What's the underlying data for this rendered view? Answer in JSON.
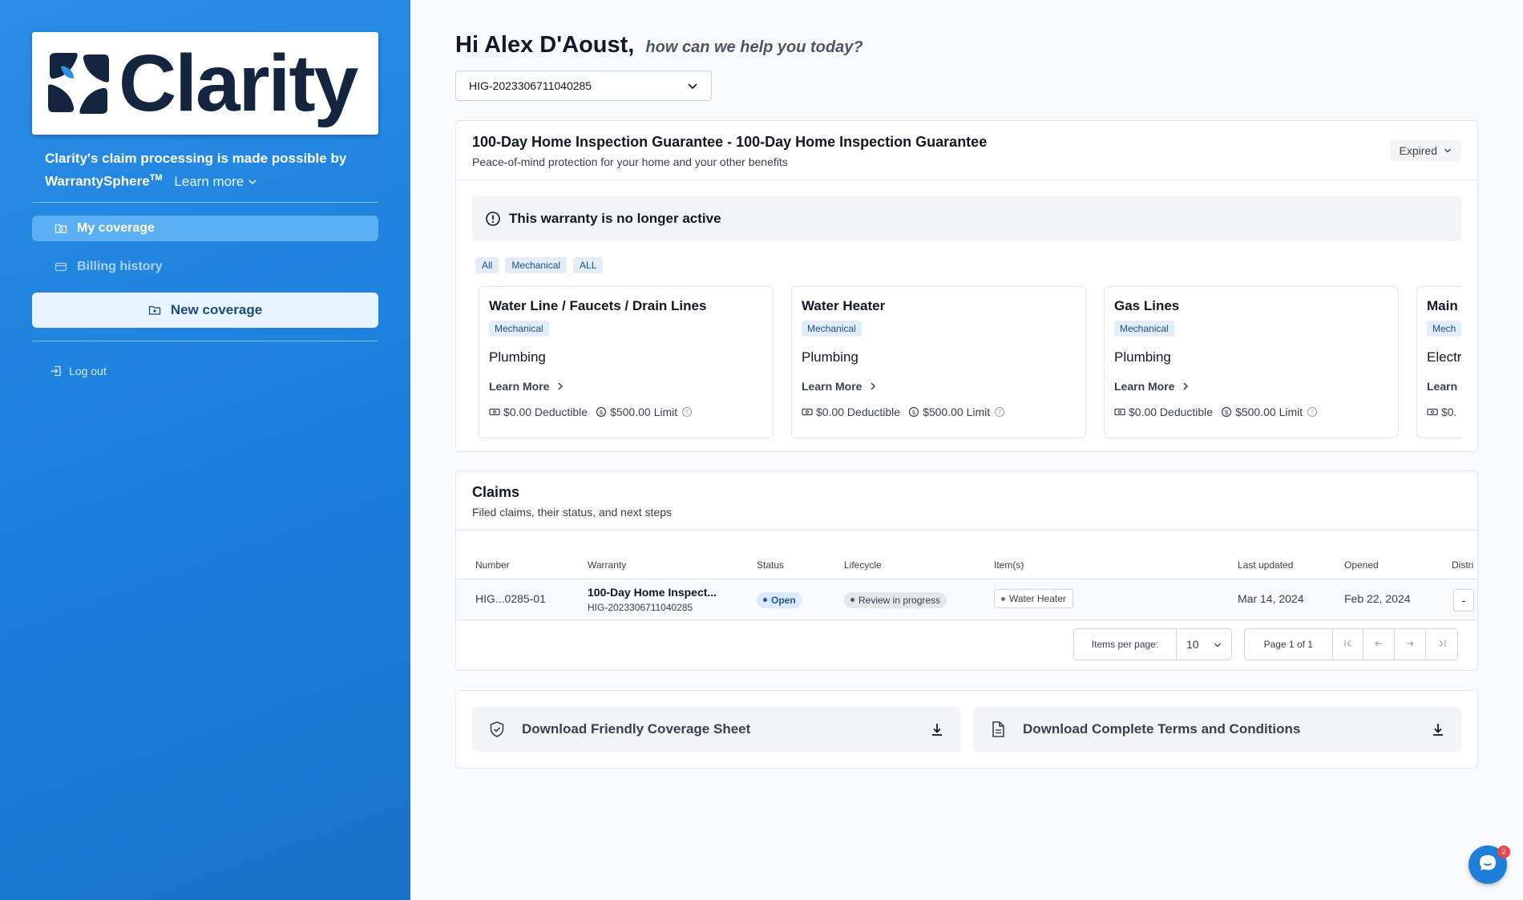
{
  "brand": {
    "logo_text": "Clarity",
    "powered_by_text": "Clarity's claim processing is made possible by",
    "partner_name": "WarrantySphere",
    "partner_mark": "TM",
    "learn_more": "Learn more",
    "logo_color": "#14263f"
  },
  "sidebar": {
    "items": [
      {
        "label": "My coverage",
        "icon": "folder-icon",
        "active": true
      },
      {
        "label": "Billing history",
        "icon": "credit-card-icon",
        "active": false
      }
    ],
    "new_coverage": "New coverage",
    "logout": "Log out",
    "accent_color": "#1a7fdc"
  },
  "header": {
    "greeting": "Hi Alex D'Aoust,",
    "subgreeting": "how can we help you today?"
  },
  "policy_select": {
    "value": "HIG-2023306711040285"
  },
  "warranty": {
    "title": "100-Day Home Inspection Guarantee - 100-Day Home Inspection Guarantee",
    "subtitle": "Peace-of-mind protection for your home and your other benefits",
    "status": "Expired",
    "alert": "This warranty is no longer active",
    "filters": [
      "All",
      "Mechanical",
      "ALL"
    ],
    "items": [
      {
        "title": "Water Line / Faucets / Drain Lines",
        "tag": "Mechanical",
        "category": "Plumbing",
        "learn_more": "Learn More",
        "deductible": "$0.00 Deductible",
        "limit": "$500.00 Limit"
      },
      {
        "title": "Water Heater",
        "tag": "Mechanical",
        "category": "Plumbing",
        "learn_more": "Learn More",
        "deductible": "$0.00 Deductible",
        "limit": "$500.00 Limit"
      },
      {
        "title": "Gas Lines",
        "tag": "Mechanical",
        "category": "Plumbing",
        "learn_more": "Learn More",
        "deductible": "$0.00 Deductible",
        "limit": "$500.00 Limit"
      },
      {
        "title": "Main",
        "tag": "Mech",
        "category": "Electr",
        "learn_more": "Learn",
        "deductible": "$0.",
        "limit": ""
      }
    ]
  },
  "claims": {
    "title": "Claims",
    "subtitle": "Filed claims, their status, and next steps",
    "columns": [
      "Number",
      "Warranty",
      "Status",
      "Lifecycle",
      "Item(s)",
      "Last updated",
      "Opened",
      "Distri"
    ],
    "rows": [
      {
        "number": "HIG...0285-01",
        "warranty_name": "100-Day Home Inspect...",
        "warranty_id": "HIG-2023306711040285",
        "status": "Open",
        "lifecycle": "Review in progress",
        "item": "Water Heater",
        "last_updated": "Mar 14, 2024",
        "opened": "Feb 22, 2024",
        "distri": "-"
      }
    ],
    "pagination": {
      "items_per_page_label": "Items per page:",
      "items_per_page": "10",
      "page_label": "Page 1 of 1"
    }
  },
  "downloads": {
    "coverage_sheet": "Download Friendly Coverage Sheet",
    "terms": "Download Complete Terms and Conditions"
  },
  "chat": {
    "badge_count": "2"
  }
}
